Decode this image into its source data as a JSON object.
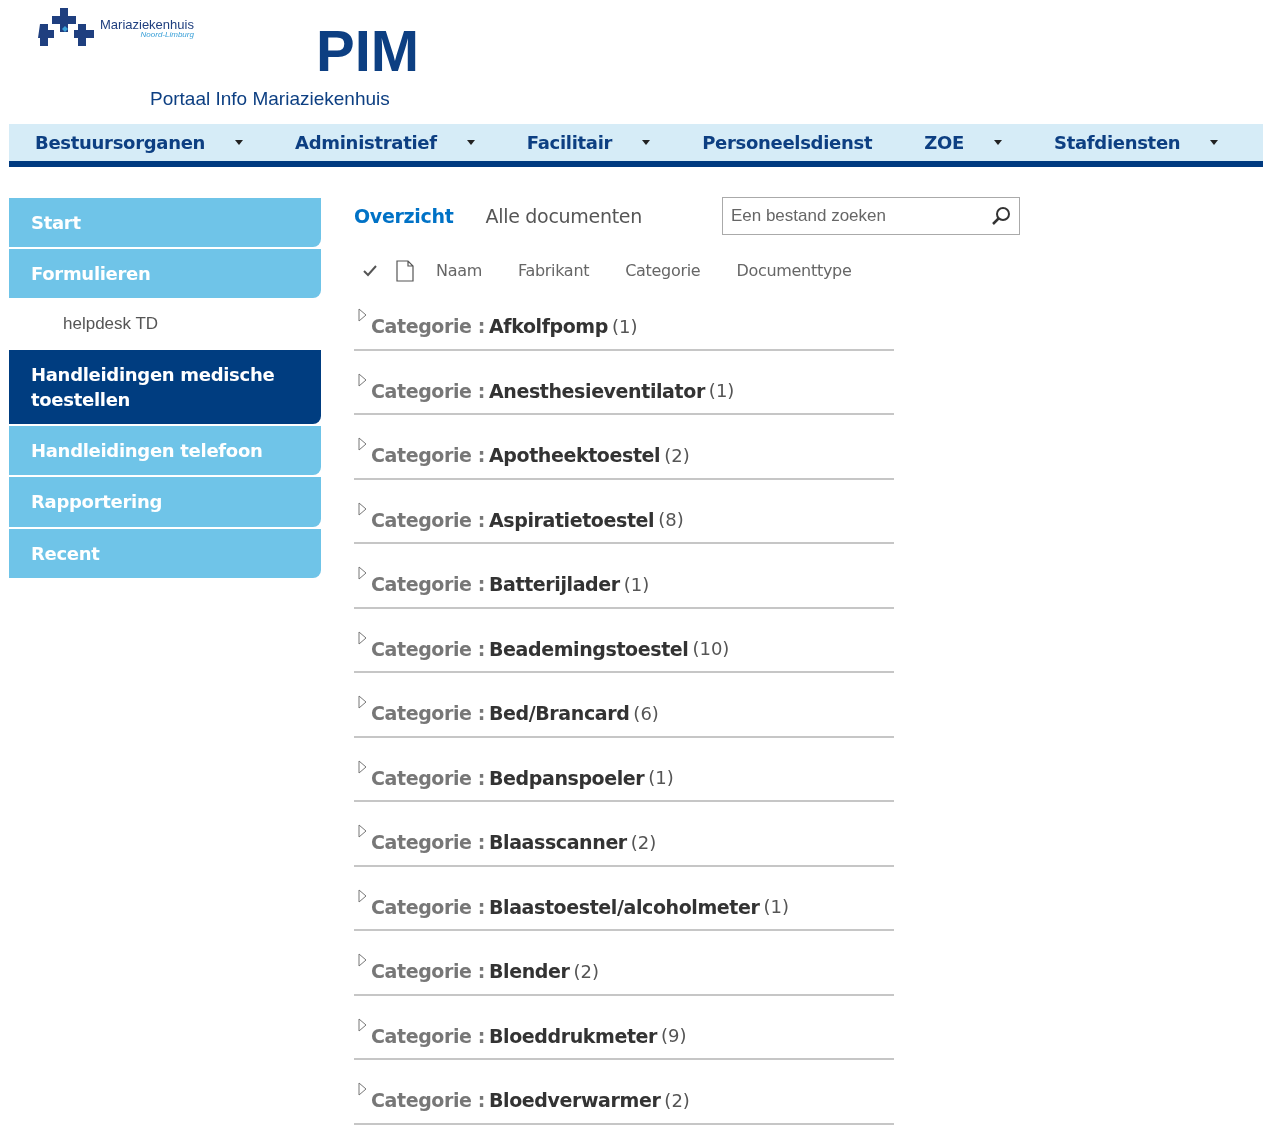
{
  "logo": {
    "name": "Mariaziekenhuis",
    "region": "Noord-Limburg"
  },
  "brand": {
    "title": "PIM",
    "subtitle": "Portaal Info Mariaziekenhuis"
  },
  "topnav": [
    {
      "label": "Bestuursorganen",
      "dropdown": true
    },
    {
      "label": "Administratief",
      "dropdown": true
    },
    {
      "label": "Facilitair",
      "dropdown": true
    },
    {
      "label": "Personeelsdienst",
      "dropdown": false
    },
    {
      "label": "ZOE",
      "dropdown": true
    },
    {
      "label": "Stafdiensten",
      "dropdown": true
    }
  ],
  "sidebar": {
    "items": [
      {
        "label": "Start",
        "kind": "tab",
        "selected": false
      },
      {
        "label": "Formulieren",
        "kind": "tab",
        "selected": false
      },
      {
        "label": "helpdesk TD",
        "kind": "sub",
        "selected": false
      },
      {
        "label": "Handleidingen medische toestellen",
        "kind": "tab",
        "selected": true
      },
      {
        "label": "Handleidingen telefoon",
        "kind": "tab",
        "selected": false
      },
      {
        "label": "Rapportering",
        "kind": "tab",
        "selected": false
      },
      {
        "label": "Recent",
        "kind": "tab",
        "selected": false
      }
    ]
  },
  "views": [
    {
      "label": "Overzicht",
      "selected": true
    },
    {
      "label": "Alle documenten",
      "selected": false
    }
  ],
  "search": {
    "placeholder": "Een bestand zoeken"
  },
  "table": {
    "columns": [
      "Naam",
      "Fabrikant",
      "Categorie",
      "Documenttype"
    ],
    "groups": [
      {
        "label": "Categorie :",
        "value": "Afkolfpomp",
        "count": "(1)"
      },
      {
        "label": "Categorie :",
        "value": "Anesthesieventilator",
        "count": "(1)"
      },
      {
        "label": "Categorie :",
        "value": "Apotheektoestel",
        "count": "(2)"
      },
      {
        "label": "Categorie :",
        "value": "Aspiratietoestel",
        "count": "(8)"
      },
      {
        "label": "Categorie :",
        "value": "Batterijlader",
        "count": "(1)"
      },
      {
        "label": "Categorie :",
        "value": "Beademingstoestel",
        "count": "(10)"
      },
      {
        "label": "Categorie :",
        "value": "Bed/Brancard",
        "count": "(6)"
      },
      {
        "label": "Categorie :",
        "value": "Bedpanspoeler",
        "count": "(1)"
      },
      {
        "label": "Categorie :",
        "value": "Blaasscanner",
        "count": "(2)"
      },
      {
        "label": "Categorie :",
        "value": "Blaastoestel/alcoholmeter",
        "count": "(1)"
      },
      {
        "label": "Categorie :",
        "value": "Blender",
        "count": "(2)"
      },
      {
        "label": "Categorie :",
        "value": "Bloeddrukmeter",
        "count": "(9)"
      },
      {
        "label": "Categorie :",
        "value": "Bloedverwarmer",
        "count": "(2)"
      }
    ]
  }
}
